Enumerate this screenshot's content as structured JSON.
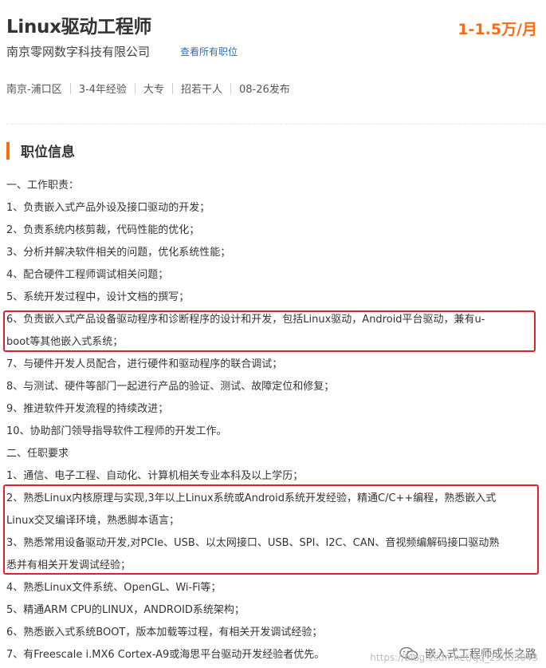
{
  "job": {
    "title": "Linux驱动工程师",
    "salary": "1-1.5万/月",
    "company": "南京零网数字科技有限公司",
    "view_all": "查看所有职位",
    "meta": [
      "南京-浦口区",
      "3-4年经验",
      "大专",
      "招若干人",
      "08-26发布"
    ]
  },
  "section": {
    "title": "职位信息"
  },
  "content": {
    "lines": [
      "一、工作职责：",
      "1、负责嵌入式产品外设及接口驱动的开发；",
      "2、负责系统内核剪裁，代码性能的优化；",
      "3、分析并解决软件相关的问题，优化系统性能；",
      "4、配合硬件工程师调试相关问题；",
      "5、系统开发过程中，设计文档的撰写；",
      "6、负责嵌入式产品设备驱动程序和诊断程序的设计和开发，包括Linux驱动，Android平台驱动，兼有u-",
      "boot等其他嵌入式系统；",
      "7、与硬件开发人员配合，进行硬件和驱动程序的联合调试；",
      "8、与测试、硬件等部门一起进行产品的验证、测试、故障定位和修复；",
      "9、推进软件开发流程的持续改进；",
      "10、协助部门领导指导软件工程师的开发工作。",
      "二、任职要求",
      "1、通信、电子工程、自动化、计算机相关专业本科及以上学历；",
      "2、熟悉Linux内核原理与实现,3年以上Linux系统或Android系统开发经验，精通C/C++编程，熟悉嵌入式",
      "Linux交叉编译环境，熟悉脚本语言；",
      "3、熟悉常用设备驱动开发,对PCIe、USB、以太网接口、USB、SPI、I2C、CAN、音视频编解码接口驱动熟",
      "悉并有相关开发调试经验；",
      "4、熟悉Linux文件系统、OpenGL、Wi-Fi等；",
      "5、精通ARM CPU的LINUX，ANDROID系统架构；",
      "6、熟悉嵌入式系统BOOT，版本加载等过程，有相关开发调试经验；",
      "7、有Freescale i.MX6 Cortex-A9或海思平台驱动开发经验者优先。"
    ]
  },
  "watermark": {
    "brand": "嵌入式工程师成长之路",
    "url": "https://blog.csdn.net/qq_29063043"
  },
  "colors": {
    "accent": "#ff6a13",
    "link": "#2c6db3",
    "highlight_box": "#e0202c"
  }
}
